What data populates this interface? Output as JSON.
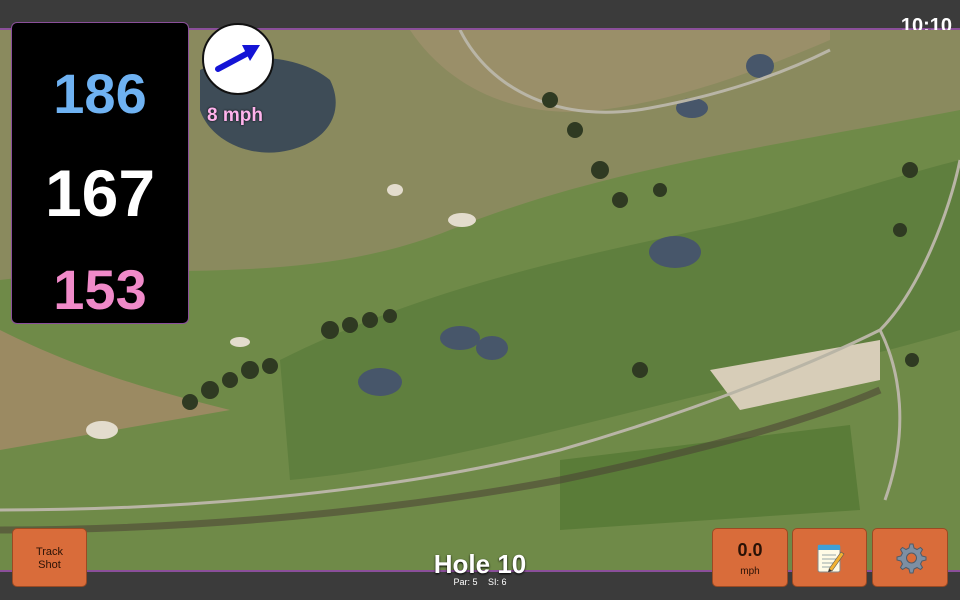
{
  "clock": {
    "time": "10:10"
  },
  "yardages": {
    "back": "186",
    "middle": "167",
    "front": "153"
  },
  "wind": {
    "speed": "8 mph",
    "direction_icon": "arrow-northeast-icon",
    "arrow_color": "#1414d6"
  },
  "hole": {
    "title": "Hole 10",
    "par_label": "Par: 5",
    "si_label": "SI: 6"
  },
  "buttons": {
    "track_shot": "Track\nShot",
    "speed_value": "0.0",
    "speed_unit": "mph",
    "notes_icon": "notepad-icon",
    "settings_icon": "gear-icon"
  },
  "colors": {
    "back_yardage": "#6fb2f2",
    "middle_yardage": "#ffffff",
    "front_yardage": "#f08ac9",
    "button": "#d96c3a",
    "accent_border": "#8a4f9a"
  }
}
